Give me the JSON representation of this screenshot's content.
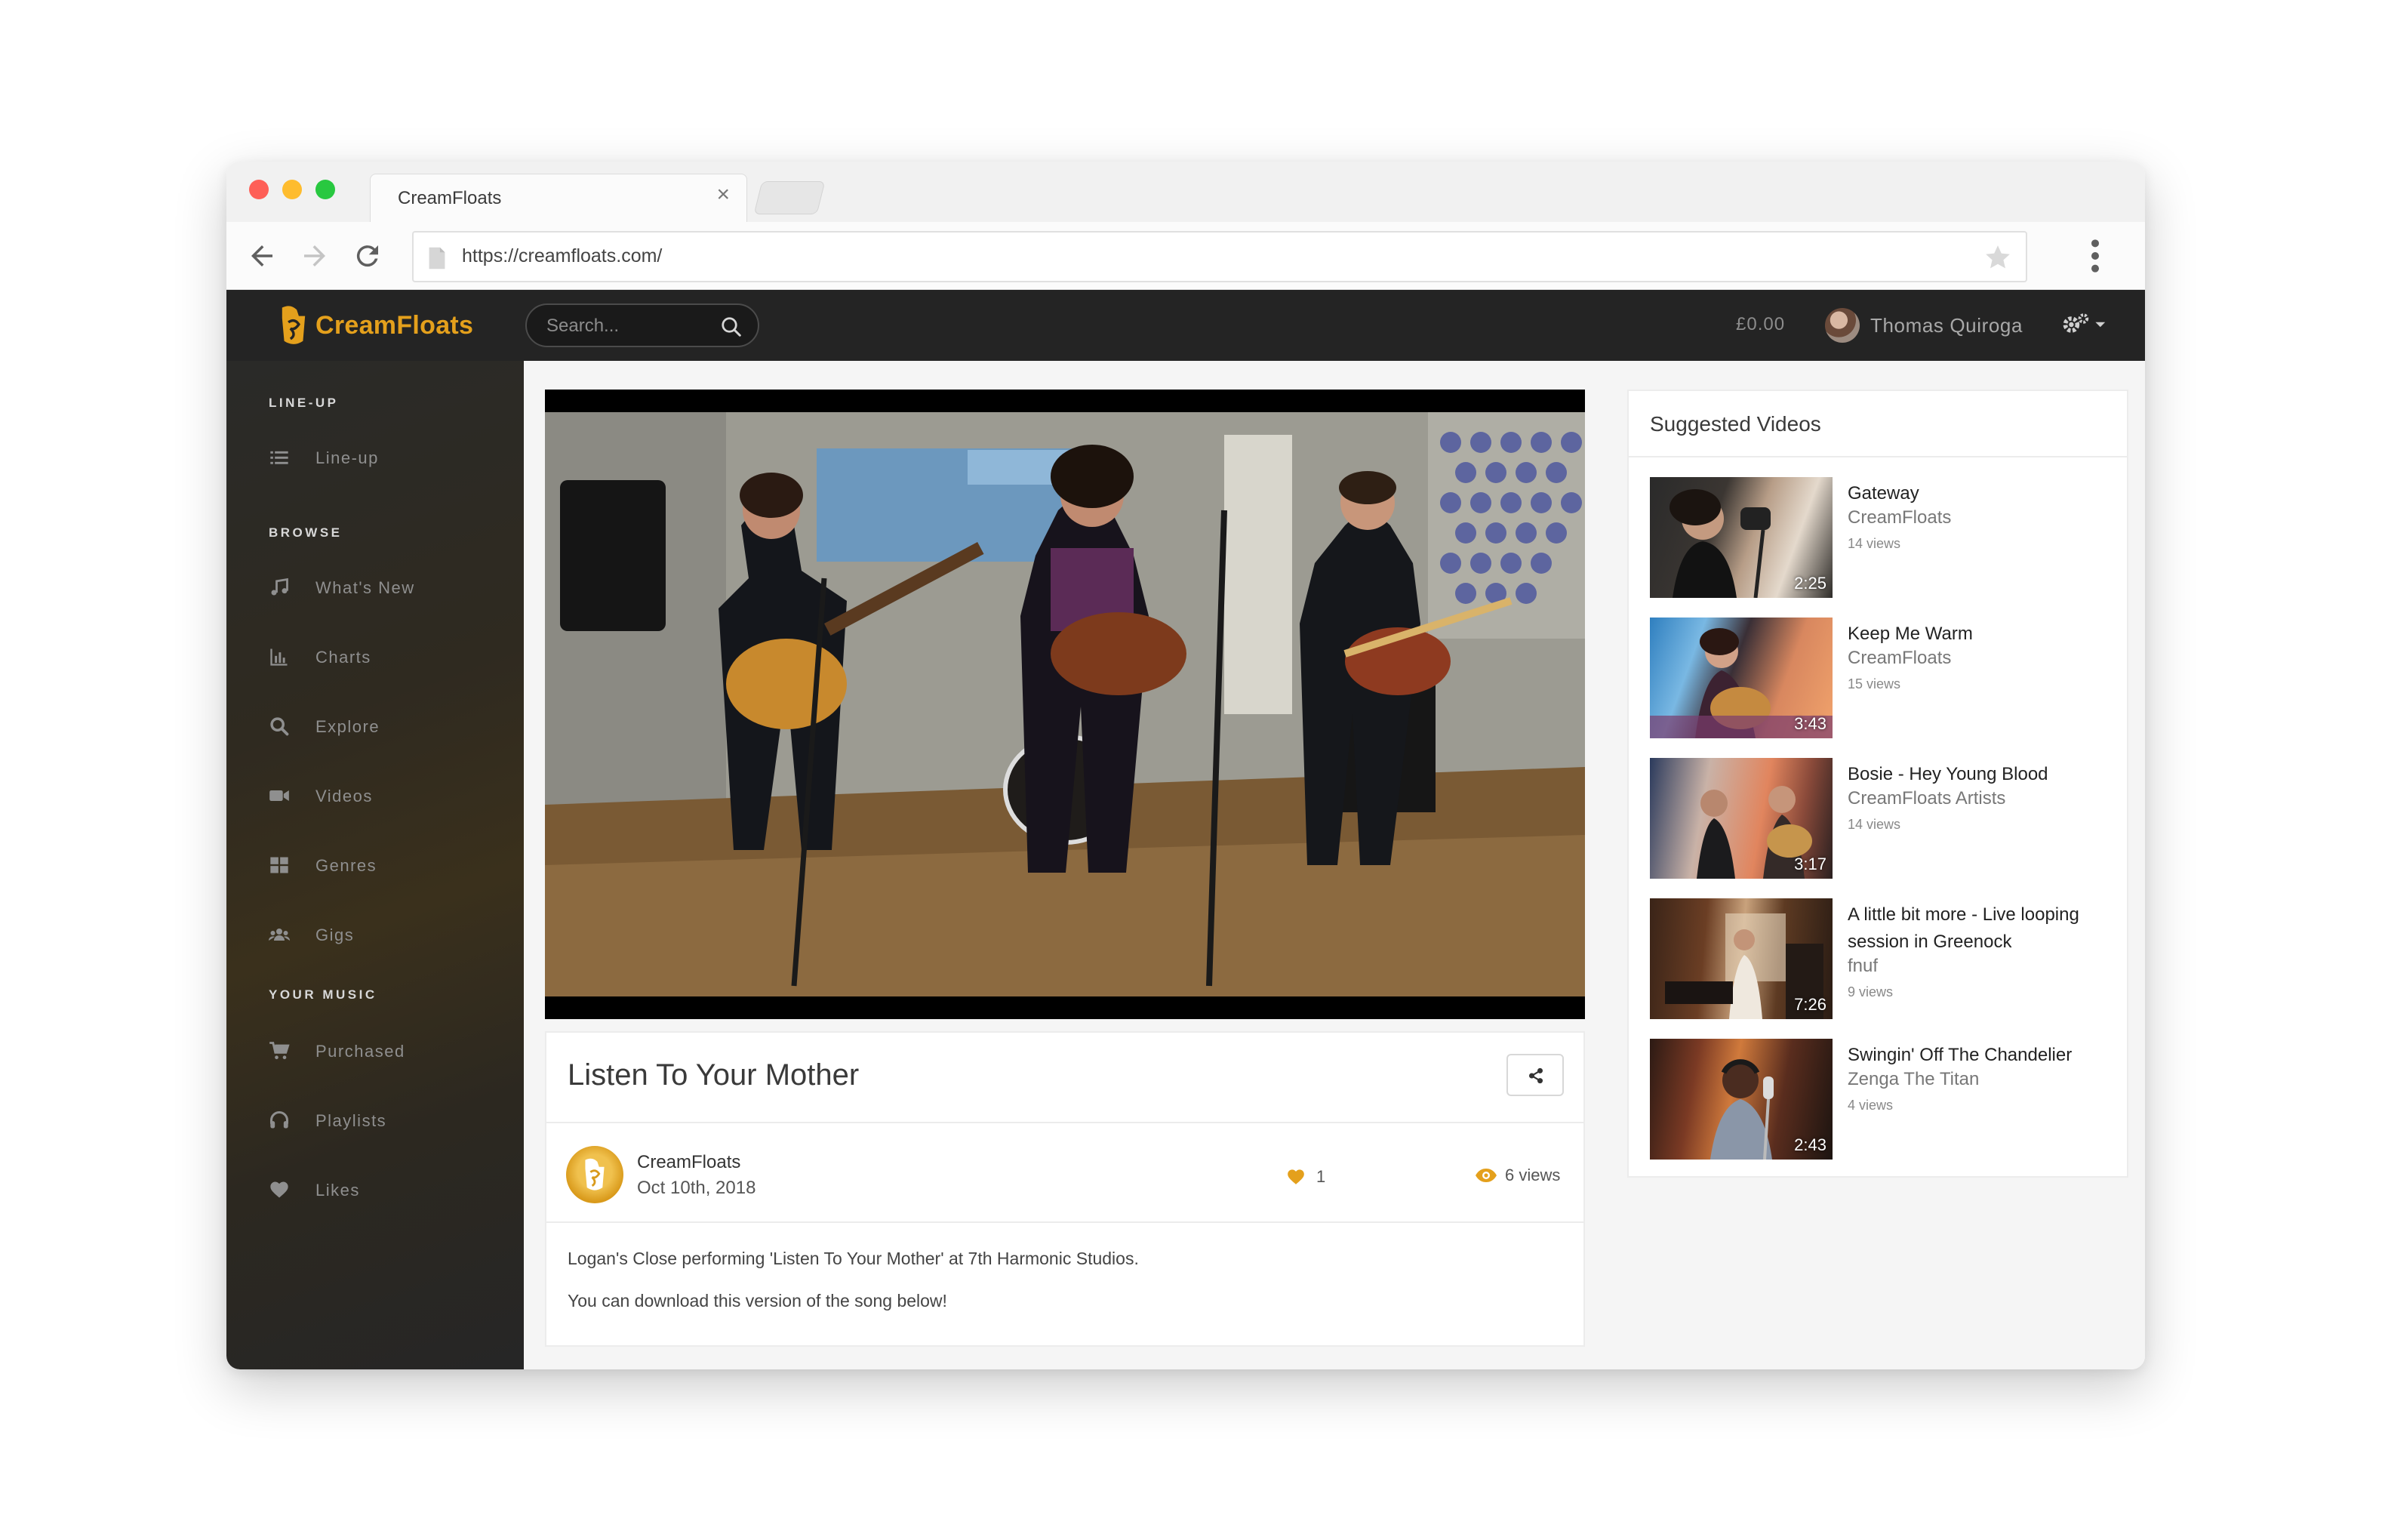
{
  "browser": {
    "tab_title": "CreamFloats",
    "url": "https://creamfloats.com/"
  },
  "app": {
    "brand": "CreamFloats",
    "brand_color": "#e4a01c",
    "search_placeholder": "Search...",
    "balance": "£0.00",
    "user_name": "Thomas Quiroga"
  },
  "sidebar": {
    "sections": [
      {
        "heading": "LINE-UP",
        "items": [
          {
            "label": "Line-up",
            "icon": "list-icon"
          }
        ]
      },
      {
        "heading": "BROWSE",
        "items": [
          {
            "label": "What's New",
            "icon": "music-note-icon"
          },
          {
            "label": "Charts",
            "icon": "bar-chart-icon"
          },
          {
            "label": "Explore",
            "icon": "search-icon"
          },
          {
            "label": "Videos",
            "icon": "video-camera-icon"
          },
          {
            "label": "Genres",
            "icon": "grid-icon"
          },
          {
            "label": "Gigs",
            "icon": "users-icon"
          }
        ]
      },
      {
        "heading": "YOUR MUSIC",
        "items": [
          {
            "label": "Purchased",
            "icon": "cart-icon"
          },
          {
            "label": "Playlists",
            "icon": "headphones-icon"
          },
          {
            "label": "Likes",
            "icon": "heart-icon"
          }
        ]
      }
    ]
  },
  "video": {
    "title": "Listen To Your Mother",
    "channel": "CreamFloats",
    "date": "Oct 10th, 2018",
    "likes": "1",
    "views": "6 views",
    "description": [
      "Logan's Close performing 'Listen To Your Mother' at 7th Harmonic Studios.",
      "You can download this version of the song below!"
    ]
  },
  "suggested": {
    "heading": "Suggested Videos",
    "items": [
      {
        "title": "Gateway",
        "channel": "CreamFloats",
        "views": "14 views",
        "duration": "2:25"
      },
      {
        "title": "Keep Me Warm",
        "channel": "CreamFloats",
        "views": "15 views",
        "duration": "3:43"
      },
      {
        "title": "Bosie - Hey Young Blood",
        "channel": "CreamFloats Artists",
        "views": "14 views",
        "duration": "3:17"
      },
      {
        "title": "A little bit more - Live looping session in Greenock",
        "channel": "fnuf",
        "views": "9 views",
        "duration": "7:26"
      },
      {
        "title": "Swingin' Off The Chandelier",
        "channel": "Zenga The Titan",
        "views": "4 views",
        "duration": "2:43"
      }
    ]
  }
}
